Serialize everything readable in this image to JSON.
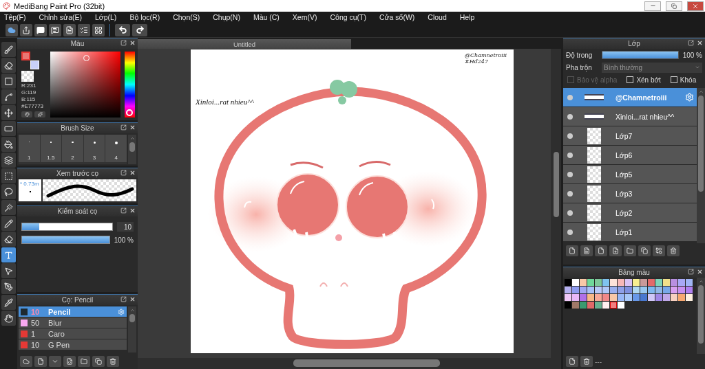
{
  "window": {
    "title": "MediBang Paint Pro (32bit)"
  },
  "menu": [
    "Tệp(F)",
    "Chỉnh sửa(E)",
    "Lớp(L)",
    "Bộ lọc(R)",
    "Chọn(S)",
    "Chụp(N)",
    "Màu (C)",
    "Xem(V)",
    "Công cụ(T)",
    "Cửa sổ(W)",
    "Cloud",
    "Help"
  ],
  "tools": [
    {
      "selected": false
    },
    {
      "selected": false
    },
    {
      "selected": false
    },
    {
      "selected": false
    },
    {
      "selected": false
    },
    {
      "selected": false
    },
    {
      "selected": false
    },
    {
      "selected": false
    },
    {
      "selected": false
    },
    {
      "selected": false
    },
    {
      "selected": false
    },
    {
      "selected": false
    },
    {
      "selected": false
    },
    {
      "selected": true
    },
    {
      "selected": false
    },
    {
      "selected": false
    },
    {
      "selected": false
    },
    {
      "selected": false
    }
  ],
  "color_panel": {
    "title": "Màu",
    "swatches": [
      {
        "color": "#e77773"
      },
      {
        "color": "#c8d0f8"
      }
    ],
    "readout": [
      "R:231",
      "G:119",
      "B:115",
      "#E77773"
    ]
  },
  "brush_size": {
    "title": "Brush Size",
    "sizes": [
      "1",
      "1.5",
      "2",
      "3",
      "4"
    ]
  },
  "brush_preview": {
    "title": "Xem trước cọ",
    "size": "* 0.73m"
  },
  "brush_control": {
    "title": "Kiểm soát cọ",
    "size": {
      "level": 0.19,
      "value": "10"
    },
    "opacity": {
      "level": 1,
      "value": "100 %"
    }
  },
  "brush_list": {
    "title": "Cọ: Pencil",
    "items": [
      {
        "color": "#1e2a30",
        "size": "10",
        "name": "Pencil",
        "selected": true
      },
      {
        "color": "#f7a8f0",
        "size": "50",
        "name": "Blur",
        "selected": false
      },
      {
        "color": "#e53935",
        "size": "1",
        "name": "Caro",
        "selected": false
      },
      {
        "color": "#e53935",
        "size": "10",
        "name": "G Pen",
        "selected": false
      }
    ]
  },
  "document": {
    "tab": "Untitled",
    "signature": [
      "@Chamnetroiii",
      "#Hd247"
    ],
    "caption": "Xinloi...rat nhieu^^"
  },
  "layers": {
    "title": "Lớp",
    "opacity": {
      "label": "Độ trong",
      "level": 1,
      "value": "100 %"
    },
    "blend": {
      "label": "Pha trộn",
      "value": "Bình thường"
    },
    "options": [
      {
        "label": "Bảo vệ alpha",
        "checked": false,
        "disabled": true
      },
      {
        "label": "Xén bớt",
        "checked": false,
        "disabled": false
      },
      {
        "label": "Khóa",
        "checked": false,
        "disabled": false
      }
    ],
    "items": [
      {
        "name": "@Chamnetroiii",
        "kind": "text",
        "selected": true
      },
      {
        "name": "Xinloi...rat nhieu^^",
        "kind": "text",
        "selected": false
      },
      {
        "name": "Lớp7",
        "kind": "raster",
        "selected": false
      },
      {
        "name": "Lớp6",
        "kind": "raster",
        "selected": false
      },
      {
        "name": "Lớp5",
        "kind": "raster",
        "selected": false
      },
      {
        "name": "Lớp3",
        "kind": "raster",
        "selected": false
      },
      {
        "name": "Lớp2",
        "kind": "raster",
        "selected": false
      },
      {
        "name": "Lớp1",
        "kind": "raster",
        "selected": false
      }
    ]
  },
  "palette": {
    "title": "Bảng màu",
    "footer": "---",
    "swatches": [
      {
        "color": "#000000",
        "selected": false
      },
      {
        "color": "#ffffff",
        "selected": false
      },
      {
        "color": "#f9c8a8",
        "selected": false
      },
      {
        "color": "#6fd79a",
        "selected": false
      },
      {
        "color": "#7fc79a",
        "selected": false
      },
      {
        "color": "#7fc4ef",
        "selected": false
      },
      {
        "color": "#fde3da",
        "selected": false
      },
      {
        "color": "#f7b8b8",
        "selected": false
      },
      {
        "color": "#d9c3f5",
        "selected": false
      },
      {
        "color": "#f8ef8f",
        "selected": false
      },
      {
        "color": "#c99a9a",
        "selected": false
      },
      {
        "color": "#e26a6a",
        "selected": false
      },
      {
        "color": "#7fd3b8",
        "selected": false
      },
      {
        "color": "#f1e08a",
        "selected": false
      },
      {
        "color": "#b98fe0",
        "selected": false
      },
      {
        "color": "#a8a8f5",
        "selected": false
      },
      {
        "color": "#a0b4f5",
        "selected": false
      },
      {
        "color": "#b5b0f0",
        "selected": false
      },
      {
        "color": "#8f9cf0",
        "selected": false
      },
      {
        "color": "#a0a8f5",
        "selected": false
      },
      {
        "color": "#a8c0f8",
        "selected": false
      },
      {
        "color": "#b8c8f8",
        "selected": false
      },
      {
        "color": "#b0c8f8",
        "selected": false
      },
      {
        "color": "#9ab0f0",
        "selected": false
      },
      {
        "color": "#8fa0e8",
        "selected": false
      },
      {
        "color": "#7f90e0",
        "selected": false
      },
      {
        "color": "#b0d8f0",
        "selected": false
      },
      {
        "color": "#98c8f0",
        "selected": false
      },
      {
        "color": "#80b8f0",
        "selected": false
      },
      {
        "color": "#90b8e8",
        "selected": false
      },
      {
        "color": "#78a8e8",
        "selected": false
      },
      {
        "color": "#d8a0f0",
        "selected": false
      },
      {
        "color": "#c890f0",
        "selected": false
      },
      {
        "color": "#b080f0",
        "selected": false
      },
      {
        "color": "#f0c8f8",
        "selected": false
      },
      {
        "color": "#e8b8f8",
        "selected": false
      },
      {
        "color": "#b070e8",
        "selected": false
      },
      {
        "color": "#f8b888",
        "selected": false
      },
      {
        "color": "#f8a898",
        "selected": false
      },
      {
        "color": "#f08888",
        "selected": false
      },
      {
        "color": "#f8c8a8",
        "selected": false
      },
      {
        "color": "#98b8f8",
        "selected": false
      },
      {
        "color": "#a8c8f8",
        "selected": false
      },
      {
        "color": "#6898e8",
        "selected": false
      },
      {
        "color": "#4878d0",
        "selected": false
      },
      {
        "color": "#d0c8f8",
        "selected": false
      },
      {
        "color": "#a088e8",
        "selected": false
      },
      {
        "color": "#c0a8e8",
        "selected": false
      },
      {
        "color": "#f8d0c0",
        "selected": false
      },
      {
        "color": "#f8a870",
        "selected": false
      },
      {
        "color": "#fff0e0",
        "selected": false
      },
      {
        "color": "#000000",
        "selected": false
      },
      {
        "color": "#a07868",
        "selected": false
      },
      {
        "color": "#3a9a70",
        "selected": false
      },
      {
        "color": "#e06868",
        "selected": false
      },
      {
        "color": "#68b090",
        "selected": false
      },
      {
        "color": "#fff0f0",
        "selected": false
      },
      {
        "color": "#f08080",
        "selected": true
      },
      {
        "color": "#ffffff",
        "selected": false
      }
    ]
  }
}
